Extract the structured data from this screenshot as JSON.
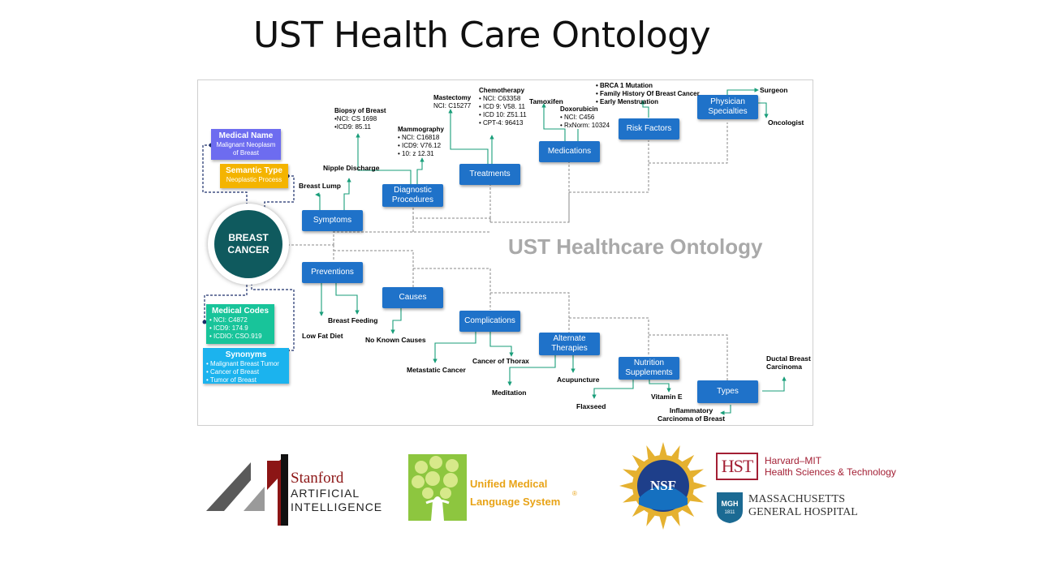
{
  "title": "UST Health Care Ontology",
  "diagram": {
    "watermark": "UST Healthcare Ontology",
    "center": [
      "BREAST",
      "CANCER"
    ],
    "cards": {
      "medical_name": {
        "title": "Medical Name",
        "lines": [
          "Malignant Neoplasm",
          "of Breast"
        ]
      },
      "semantic_type": {
        "title": "Semantic Type",
        "lines": [
          "Neoplastic Process"
        ]
      },
      "medical_codes": {
        "title": "Medical Codes",
        "lines": [
          "• NCI: C4872",
          "• ICD9: 174.9",
          "• ICDIO: CSO.919"
        ]
      },
      "synonyms": {
        "title": "Synonyms",
        "lines": [
          "• Malignant Breast Tumor",
          "• Cancer of Breast",
          "• Tumor of Breast"
        ]
      }
    },
    "nodes": {
      "symptoms": "Symptoms",
      "diagnostic": [
        "Diagnostic",
        "Procedures"
      ],
      "treatments": "Treatments",
      "medications": "Medications",
      "risk_factors": "Risk Factors",
      "physician": [
        "Physician",
        "Specialties"
      ],
      "preventions": "Preventions",
      "causes": "Causes",
      "complications": "Complications",
      "alternate": [
        "Alternate",
        "Therapies"
      ],
      "nutrition": [
        "Nutrition",
        "Supplements"
      ],
      "types": "Types"
    },
    "labels": {
      "breast_lump": "Breast Lump",
      "nipple_discharge": "Nipple Discharge",
      "biopsy": {
        "title": "Biopsy of Breast",
        "lines": [
          "•NCI: CS 1698",
          "•ICD9: 85.11"
        ]
      },
      "mammography": {
        "title": "Mammography",
        "lines": [
          "• NCI: C16818",
          "• ICD9: V76.12",
          "• 10: z 12.31"
        ]
      },
      "mastectomy": {
        "title": "Mastectomy",
        "lines": [
          "NCI: C15277"
        ]
      },
      "chemotherapy": {
        "title": "Chemotherapy",
        "lines": [
          "• NCI: C63358",
          "• ICD 9: V58. 11",
          "• ICD 10: Z51.11",
          "• CPT-4: 96413"
        ]
      },
      "tamoxifen": "Tamoxifen",
      "doxorubicin": {
        "title": "Doxorubicin",
        "lines": [
          "• NCI: C456",
          "• RxNorm: 10324"
        ]
      },
      "risks": [
        "• BRCA 1 Mutation",
        "• Family History Of Breast Cancer",
        "• Early Menstruation"
      ],
      "surgeon": "Surgeon",
      "oncologist": "Oncologist",
      "breast_feeding": "Breast Feeding",
      "low_fat_diet": "Low Fat Diet",
      "no_known_causes": "No Known Causes",
      "cancer_of_thorax": "Cancer of Thorax",
      "metastatic_cancer": "Metastatic Cancer",
      "acupuncture": "Acupuncture",
      "meditation": "Meditation",
      "vitamin_e": "Vitamin E",
      "flaxseed": "Flaxseed",
      "ductal": [
        "Ductal Breast",
        "Carcinoma"
      ],
      "inflammatory": [
        "Inflammatory",
        "Carcinoma of Breast"
      ]
    }
  },
  "logos": {
    "stanford": [
      "Stanford",
      "ARTIFICIAL",
      "INTELLIGENCE"
    ],
    "umls": [
      "Unified Medical",
      "Language System"
    ],
    "umls_mark": "®",
    "nsf": "NSF",
    "hst_mark": "HST",
    "hst": [
      "Harvard–MIT",
      "Health Sciences & Technology"
    ],
    "mgh_mark": "MGH",
    "mgh_year": "1811",
    "mgh": [
      "MASSACHUSETTS",
      "GENERAL HOSPITAL"
    ]
  }
}
